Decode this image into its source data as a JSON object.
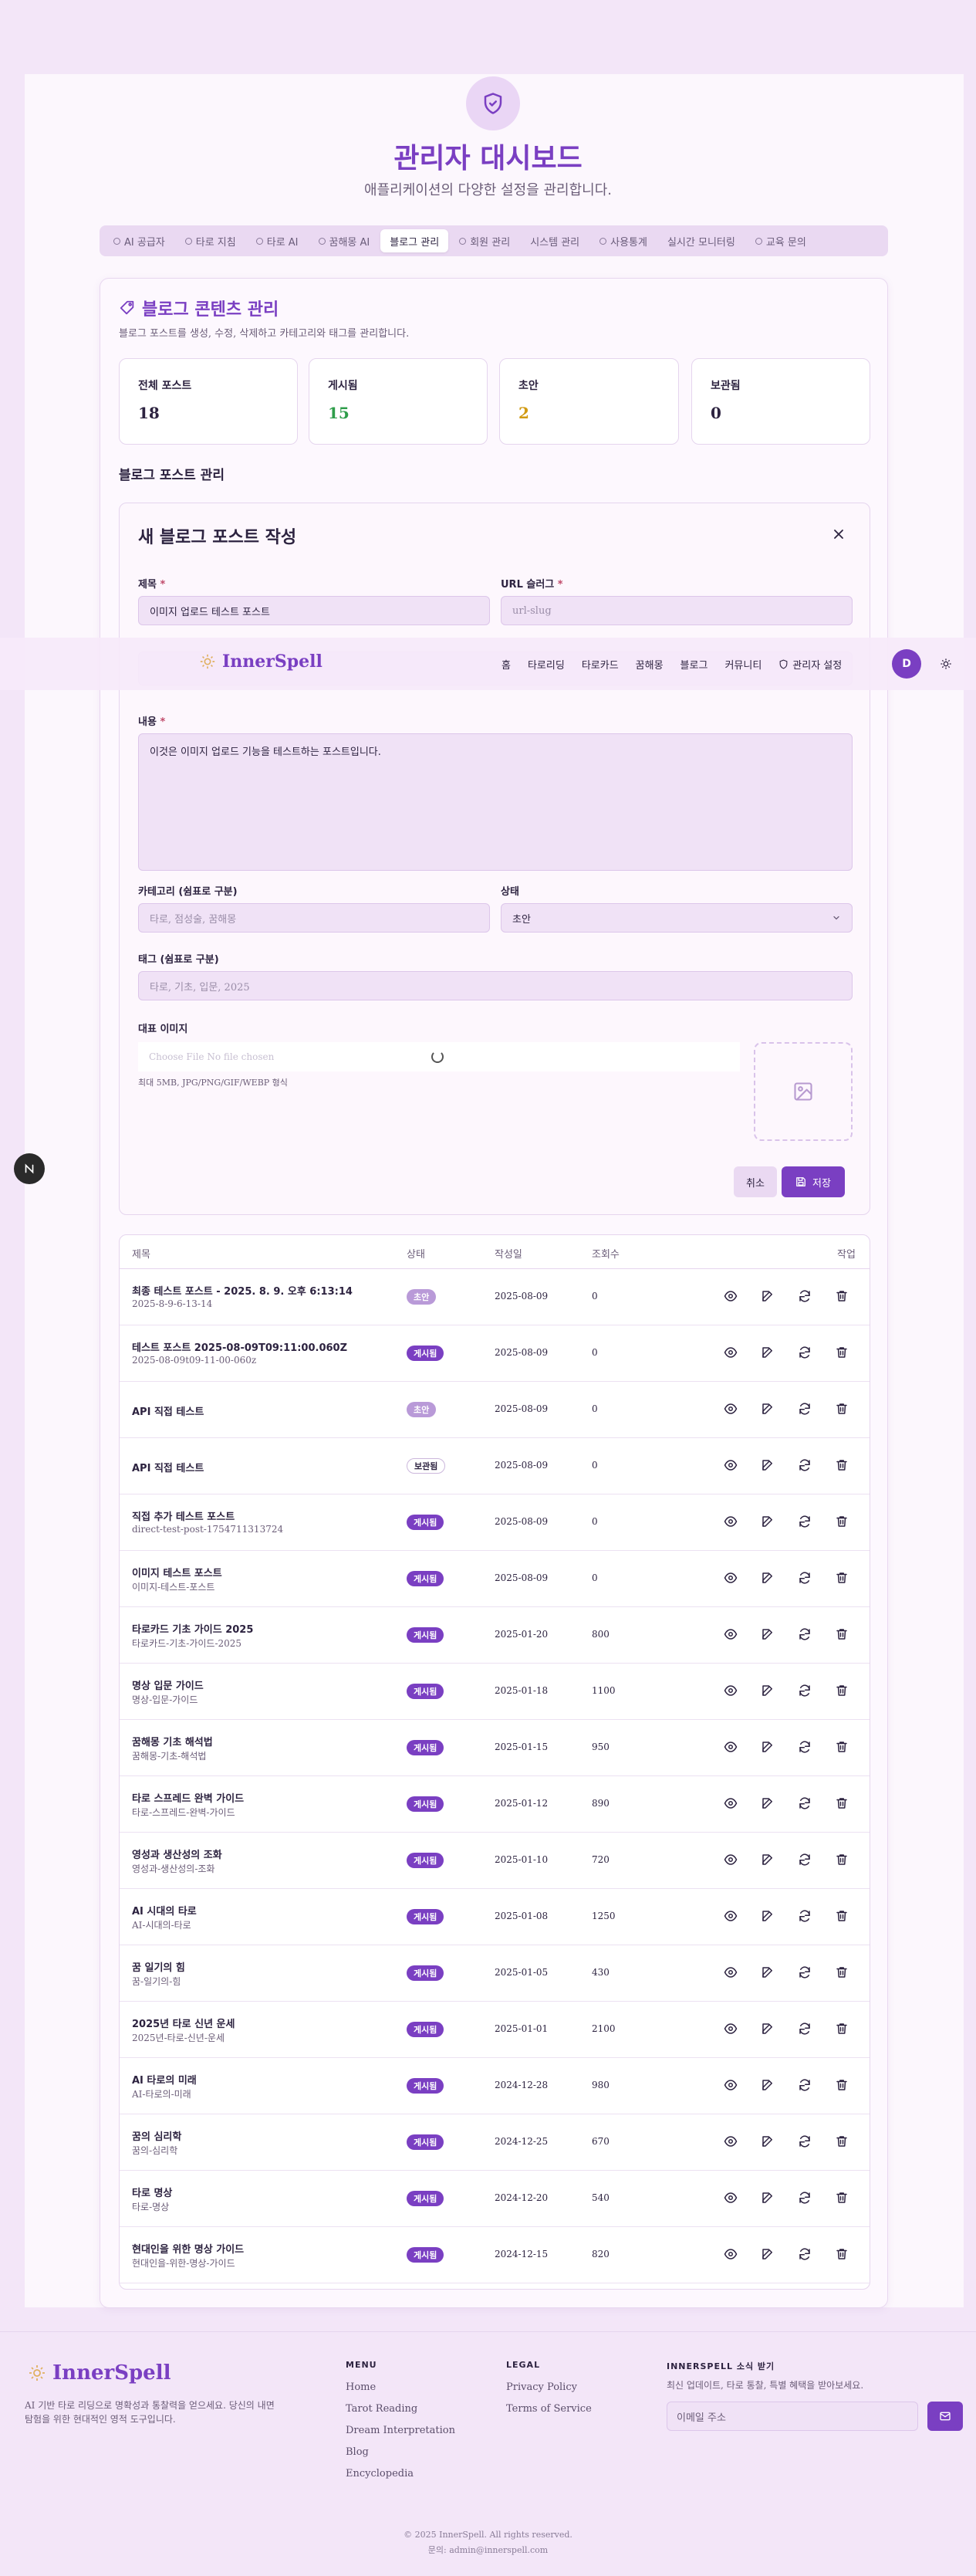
{
  "header": {
    "title": "관리자 대시보드",
    "subtitle": "애플리케이션의 다양한 설정을 관리합니다."
  },
  "tabs": [
    {
      "label": "AI 공급자",
      "icon": "sparkle-icon",
      "active": false
    },
    {
      "label": "타로 지침",
      "icon": "book-icon",
      "active": false
    },
    {
      "label": "타로 AI",
      "icon": "target-icon",
      "active": false
    },
    {
      "label": "꿈해몽 AI",
      "icon": "moon-icon",
      "active": false
    },
    {
      "label": "블로그 관리",
      "icon": "",
      "active": true
    },
    {
      "label": "회원 관리",
      "icon": "users-icon",
      "active": false
    },
    {
      "label": "시스템 관리",
      "icon": "",
      "active": false
    },
    {
      "label": "사용통계",
      "icon": "chart-icon",
      "active": false
    },
    {
      "label": "실시간 모니터링",
      "icon": "",
      "active": false
    },
    {
      "label": "교육 문의",
      "icon": "mail-icon",
      "active": false
    }
  ],
  "blog": {
    "title": "블로그 콘텐츠 관리",
    "description": "블로그 포스트를 생성, 수정, 삭제하고 카테고리와 태그를 관리합니다.",
    "stats": [
      {
        "label": "전체 포스트",
        "value": "18",
        "color": "#2d2340"
      },
      {
        "label": "게시됨",
        "value": "15",
        "color": "#2e9d4a"
      },
      {
        "label": "초안",
        "value": "2",
        "color": "#d19a12"
      },
      {
        "label": "보관됨",
        "value": "0",
        "color": "#2d2340"
      }
    ],
    "section_title": "블로그 포스트 관리"
  },
  "form": {
    "title": "새 블로그 포스트 작성",
    "title_label": "제목",
    "title_value": "이미지 업로드 테스트 포스트",
    "slug_label": "URL 슬러그",
    "slug_placeholder": "url-slug",
    "content_label": "내용",
    "content_value": "이것은 이미지 업로드 기능을 테스트하는 포스트입니다.",
    "category_label": "카테고리 (쉼표로 구분)",
    "category_placeholder": "타로, 점성술, 꿈해몽",
    "status_label": "상태",
    "status_value": "초안",
    "tags_label": "태그 (쉼표로 구분)",
    "tags_placeholder": "타로, 기초, 입문, 2025",
    "image_label": "대표 이미지",
    "file_placeholder": "Choose File   No file chosen",
    "file_hint": "최대 5MB, JPG/PNG/GIF/WEBP 형식",
    "cancel_label": "취소",
    "save_label": "저장"
  },
  "nav": {
    "brand": "InnerSpell",
    "links": [
      "홈",
      "타로리딩",
      "타로카드",
      "꿈해몽",
      "블로그",
      "커뮤니티"
    ],
    "admin_label": "관리자 설정",
    "avatar": "D"
  },
  "table": {
    "headers": [
      "제목",
      "상태",
      "작성일",
      "조회수",
      "작업"
    ],
    "rows": [
      {
        "title": "최종 테스트 포스트 - 2025. 8. 9. 오후 6:13:14",
        "slug": "2025-8-9-6-13-14",
        "status": "초안",
        "kind": "draft",
        "date": "2025-08-09",
        "views": "0"
      },
      {
        "title": "테스트 포스트 2025-08-09T09:11:00.060Z",
        "slug": "2025-08-09t09-11-00-060z",
        "status": "게시됨",
        "kind": "pub",
        "date": "2025-08-09",
        "views": "0"
      },
      {
        "title": "API 직접 테스트",
        "slug": "",
        "status": "초안",
        "kind": "draft",
        "date": "2025-08-09",
        "views": "0"
      },
      {
        "title": "API 직접 테스트",
        "slug": "",
        "status": "보관됨",
        "kind": "arch",
        "date": "2025-08-09",
        "views": "0"
      },
      {
        "title": "직접 추가 테스트 포스트",
        "slug": "direct-test-post-1754711313724",
        "status": "게시됨",
        "kind": "pub",
        "date": "2025-08-09",
        "views": "0"
      },
      {
        "title": "이미지 테스트 포스트",
        "slug": "이미지-테스트-포스트",
        "status": "게시됨",
        "kind": "pub",
        "date": "2025-08-09",
        "views": "0"
      },
      {
        "title": "타로카드 기초 가이드 2025",
        "slug": "타로카드-기초-가이드-2025",
        "status": "게시됨",
        "kind": "pub",
        "date": "2025-01-20",
        "views": "800"
      },
      {
        "title": "명상 입문 가이드",
        "slug": "명상-입문-가이드",
        "status": "게시됨",
        "kind": "pub",
        "date": "2025-01-18",
        "views": "1100"
      },
      {
        "title": "꿈해몽 기초 해석법",
        "slug": "꿈해몽-기초-해석법",
        "status": "게시됨",
        "kind": "pub",
        "date": "2025-01-15",
        "views": "950"
      },
      {
        "title": "타로 스프레드 완벽 가이드",
        "slug": "타로-스프레드-완벽-가이드",
        "status": "게시됨",
        "kind": "pub",
        "date": "2025-01-12",
        "views": "890"
      },
      {
        "title": "영성과 생산성의 조화",
        "slug": "영성과-생산성의-조화",
        "status": "게시됨",
        "kind": "pub",
        "date": "2025-01-10",
        "views": "720"
      },
      {
        "title": "AI 시대의 타로",
        "slug": "AI-시대의-타로",
        "status": "게시됨",
        "kind": "pub",
        "date": "2025-01-08",
        "views": "1250"
      },
      {
        "title": "꿈 일기의 힘",
        "slug": "꿈-일기의-힘",
        "status": "게시됨",
        "kind": "pub",
        "date": "2025-01-05",
        "views": "430"
      },
      {
        "title": "2025년 타로 신년 운세",
        "slug": "2025년-타로-신년-운세",
        "status": "게시됨",
        "kind": "pub",
        "date": "2025-01-01",
        "views": "2100"
      },
      {
        "title": "AI 타로의 미래",
        "slug": "AI-타로의-미래",
        "status": "게시됨",
        "kind": "pub",
        "date": "2024-12-28",
        "views": "980"
      },
      {
        "title": "꿈의 심리학",
        "slug": "꿈의-심리학",
        "status": "게시됨",
        "kind": "pub",
        "date": "2024-12-25",
        "views": "670"
      },
      {
        "title": "타로 명상",
        "slug": "타로-명상",
        "status": "게시됨",
        "kind": "pub",
        "date": "2024-12-20",
        "views": "540"
      },
      {
        "title": "현대인을 위한 명상 가이드",
        "slug": "현대인을-위한-명상-가이드",
        "status": "게시됨",
        "kind": "pub",
        "date": "2024-12-15",
        "views": "820"
      }
    ]
  },
  "footer": {
    "brand": "InnerSpell",
    "description_line1": "AI 기반 타로 리딩으로 명확성과 통찰력을 얻으세요. 당신의 내면",
    "description_line2": "탐험을 위한 현대적인 영적 도구입니다.",
    "menu_heading": "MENU",
    "menu_links": [
      "Home",
      "Tarot Reading",
      "Dream Interpretation",
      "Blog",
      "Encyclopedia"
    ],
    "legal_heading": "LEGAL",
    "legal_links": [
      "Privacy Policy",
      "Terms of Service"
    ],
    "news_heading": "INNERSPELL 소식 받기",
    "news_desc": "최신 업데이트, 타로 통찰, 특별 혜택을 받아보세요.",
    "email_placeholder": "이메일 주소",
    "copyright": "© 2025 InnerSpell. All rights reserved.",
    "contact": "문의: admin@innerspell.com"
  },
  "colors": {
    "accent": "#7a3fc2",
    "background": "#f3e6f8",
    "published": "#2e9d4a",
    "draft": "#d19a12"
  }
}
